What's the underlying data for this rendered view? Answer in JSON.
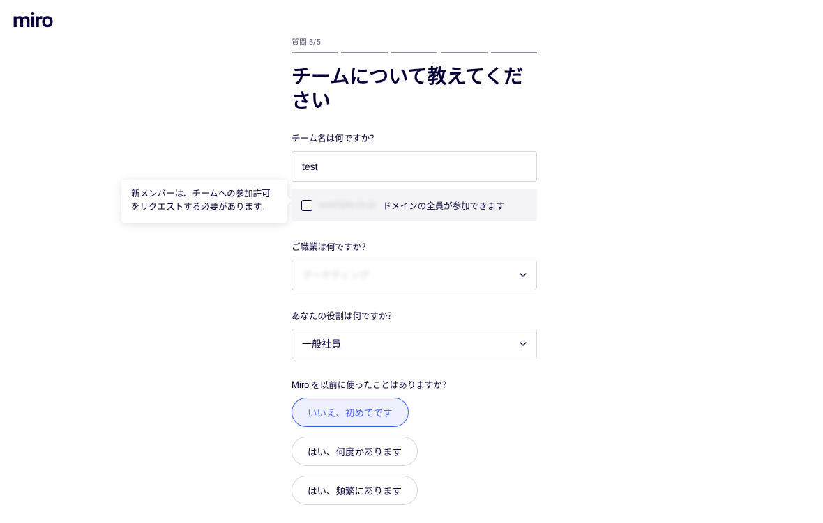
{
  "logo": "miro",
  "step": "質問 5/5",
  "title": "チームについて教えてください",
  "teamName": {
    "label": "チーム名は何ですか？",
    "value": "test",
    "domainBlurred": "example.co.jp",
    "domainSuffix": "ドメインの全員が参加できます"
  },
  "occupation": {
    "label": "ご職業は何ですか？",
    "valueBlurred": "マーケティング"
  },
  "role": {
    "label": "あなたの役割は何ですか？",
    "value": "一般社員"
  },
  "experience": {
    "label": "Miro を以前に使ったことはありますか？",
    "options": [
      {
        "label": "いいえ、初めてです",
        "selected": true
      },
      {
        "label": "はい、何度かあります",
        "selected": false
      },
      {
        "label": "はい、頻繁にあります",
        "selected": false
      }
    ]
  },
  "tooltip": "新メンバーは、チームへの参加許可をリクエストする必要があります。"
}
